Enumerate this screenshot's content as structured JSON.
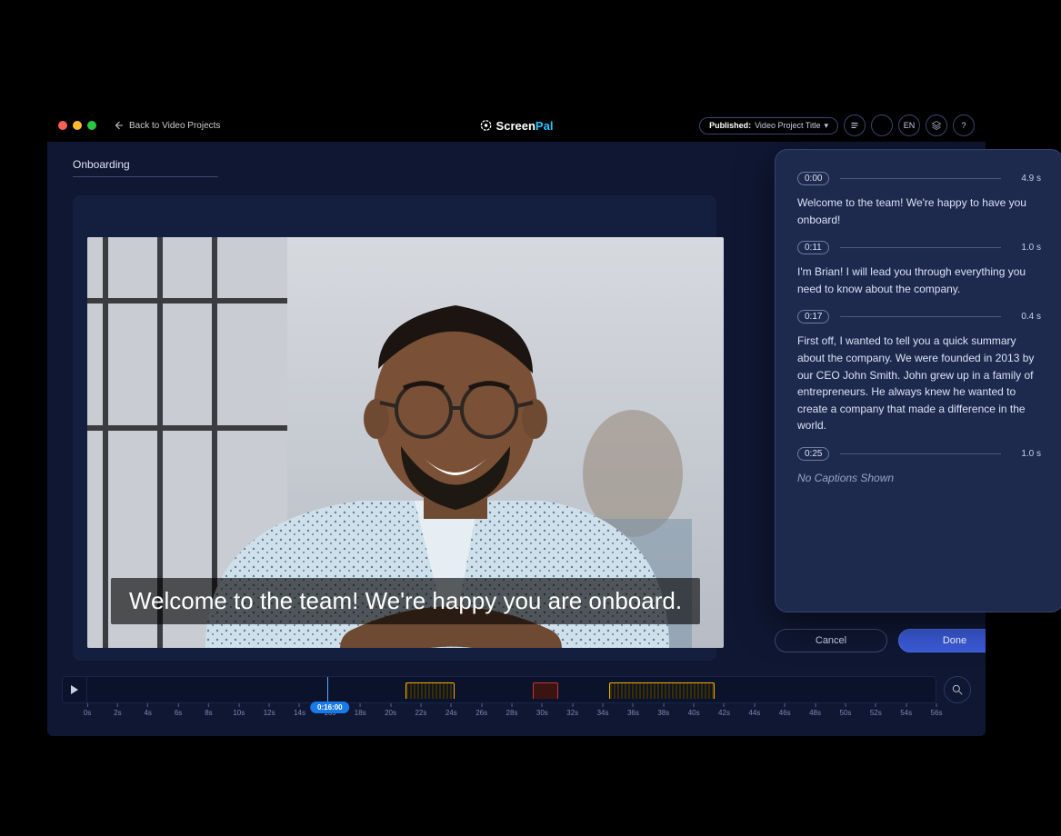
{
  "titlebar": {
    "back_label": "Back to Video Projects",
    "brand_a": "Screen",
    "brand_b": "Pal",
    "publish_label": "Published:",
    "publish_value": "Video Project Title",
    "lang": "EN"
  },
  "tab_title": "Onboarding",
  "video": {
    "caption_text": "Welcome to the team! We're happy you are onboard."
  },
  "captions": [
    {
      "time": "0:00",
      "dur": "4.9 s",
      "text": "Welcome to the team! We're happy to have you onboard!"
    },
    {
      "time": "0:11",
      "dur": "1.0 s",
      "text": "I'm Brian! I will lead you through everything you need to know about the company."
    },
    {
      "time": "0:17",
      "dur": "0.4 s",
      "text": "First off, I wanted to tell you a quick summary about the company. We were founded in 2013 by our CEO John Smith. John grew up in a family of entrepreneurs. He always knew he wanted to create a company that made a difference in the world."
    },
    {
      "time": "0:25",
      "dur": "1.0 s",
      "text": "No Captions Shown",
      "empty": true
    }
  ],
  "buttons": {
    "cancel": "Cancel",
    "done": "Done"
  },
  "timeline": {
    "playhead_pct": 28.3,
    "current_time_label": "0:16:00",
    "ticks": [
      "0s",
      "2s",
      "4s",
      "6s",
      "8s",
      "10s",
      "12s",
      "14s",
      "16s",
      "18s",
      "20s",
      "22s",
      "24s",
      "26s",
      "28s",
      "30s",
      "32s",
      "34s",
      "36s",
      "38s",
      "40s",
      "42s",
      "44s",
      "46s",
      "48s",
      "50s",
      "52s",
      "54s",
      "56s"
    ],
    "ticks_per_line": 29,
    "segments": [
      {
        "cls": "y",
        "left_pct": 37.5,
        "width_pct": 5.8
      },
      {
        "cls": "r",
        "left_pct": 52.5,
        "width_pct": 3.0
      },
      {
        "cls": "y",
        "left_pct": 61.5,
        "width_pct": 12.5
      }
    ]
  }
}
